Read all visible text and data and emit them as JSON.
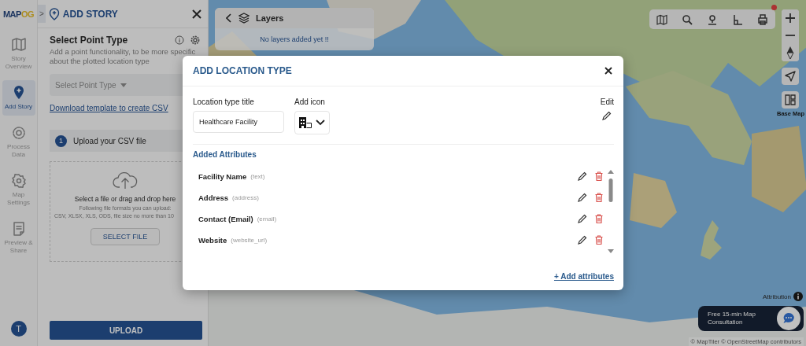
{
  "logo": {
    "text": "MAP",
    "accent": "OG"
  },
  "rail": {
    "items": [
      {
        "label": "Story Overview",
        "kind": "map",
        "selected": false
      },
      {
        "label": "Add Story",
        "kind": "pin",
        "selected": true
      },
      {
        "label": "Process Data",
        "kind": "gear",
        "selected": false
      },
      {
        "label": "Map Settings",
        "kind": "cog",
        "selected": false
      },
      {
        "label": "Preview & Share",
        "kind": "note",
        "selected": false
      }
    ],
    "avatar": "T"
  },
  "panel": {
    "expand_toggle": ">",
    "title": "ADD STORY",
    "section_title": "Select Point Type",
    "description": "Add a point functionality, to be more specific about the plotted location type",
    "point_type_select": {
      "placeholder": "Select Point Type"
    },
    "template_link": "Download template to create CSV",
    "step": {
      "number": "1",
      "label": "Upload your CSV file"
    },
    "dropzone": {
      "title": "Select a file or drag and drop here",
      "hint_1": "Following file formats you can upload:",
      "hint_2": "CSV, XLSX, XLS, ODS, file size no more than 10",
      "button": "SELECT FILE"
    },
    "upload_button": "UPLOAD"
  },
  "layers": {
    "title": "Layers",
    "empty_message": "No layers added yet !!"
  },
  "map": {
    "base_map_label": "Base Map",
    "attribution": "Attribution",
    "consultation": "Free 15-min Map Consultation",
    "credits": "© MapTiler © OpenStreetMap contributors"
  },
  "modal": {
    "title": "ADD LOCATION TYPE",
    "title_label": "Location type title",
    "title_field": {
      "value": "Healthcare Facility"
    },
    "icon_label": "Add icon",
    "edit_label": "Edit",
    "attributes_heading": "Added Attributes",
    "attributes": [
      {
        "name": "Facility Name",
        "type": "(text)"
      },
      {
        "name": "Address",
        "type": "(address)"
      },
      {
        "name": "Contact (Email)",
        "type": "(email)"
      },
      {
        "name": "Website",
        "type": "(website_url)"
      }
    ],
    "add_link": "+ Add attributes"
  }
}
